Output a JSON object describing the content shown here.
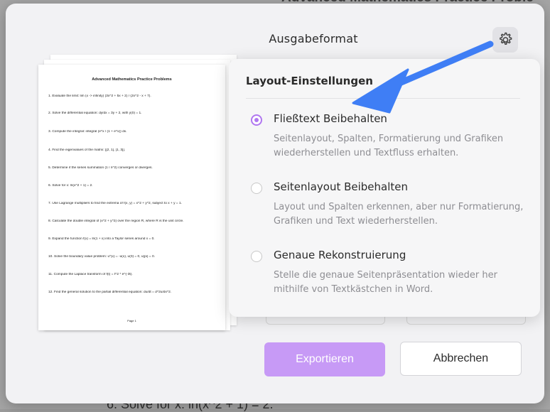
{
  "background": {
    "doc_title": "Advanced Mathematics Practice Proble",
    "doc_line": "6. Solve for x: ln(x^2 + 1) = 2."
  },
  "dialog": {
    "title": "Ausgabeformat",
    "settings_icon": "gear-icon"
  },
  "preview": {
    "title": "Advanced Mathematics Practice Problems",
    "items": [
      "1. Evaluate the limit: lim (x -> infinity) (3x^2 + 5x + 2) / (2x^2 - x + 7).",
      "2. Solve the differential equation: dy/dx = 3y + 2, with y(0) = 1.",
      "3. Compute the integral: integral (e^x / (1 + e^x)) dx.",
      "4. Find the eigenvalues of the matrix: [[2, 1], [1, 3]].",
      "5. Determine if the series summation (1 / n^2) converges or diverges.",
      "6. Solve for x: ln(x^2 + 1) = 2.",
      "7. Use Lagrange multipliers to find the extrema of f(x, y) = x^2 + y^2, subject to x + y = 1.",
      "8. Calculate the double integral of (x^2 + y^2) over the region R, where R is the unit circle.",
      "9. Expand the function f(x) = ln(1 + x) into a Taylor series around x = 0.",
      "10. Solve the boundary value problem: u''(x) = -u(x), u(0) = 0, u(pi) = 0.",
      "11. Compute the Laplace transform of f(t) = t^2 * e^(-3t).",
      "12. Find the general solution to the partial differential equation: du/dt = d^2u/dx^2."
    ],
    "page_label": "Page 1"
  },
  "layout_settings": {
    "title": "Layout-Einstellungen",
    "options": [
      {
        "label": "Fließtext Beibehalten",
        "description": "Seitenlayout, Spalten, Formatierung und Grafiken wiederherstellen und Textfluss erhalten.",
        "selected": true
      },
      {
        "label": "Seitenlayout Beibehalten",
        "description": "Layout und Spalten erkennen, aber nur Formatierung, Grafiken und Text wiederherstellen.",
        "selected": false
      },
      {
        "label": "Genaue Rekonstruierung",
        "description": "Stelle die genaue Seitenpräsentation wieder her mithilfe von Textkästchen in Word.",
        "selected": false
      }
    ]
  },
  "buttons": {
    "export": "Exportieren",
    "cancel": "Abbrechen"
  },
  "colors": {
    "accent": "#b077f0",
    "export_button": "#c79af6",
    "annotation_arrow": "#3f7ef5"
  }
}
